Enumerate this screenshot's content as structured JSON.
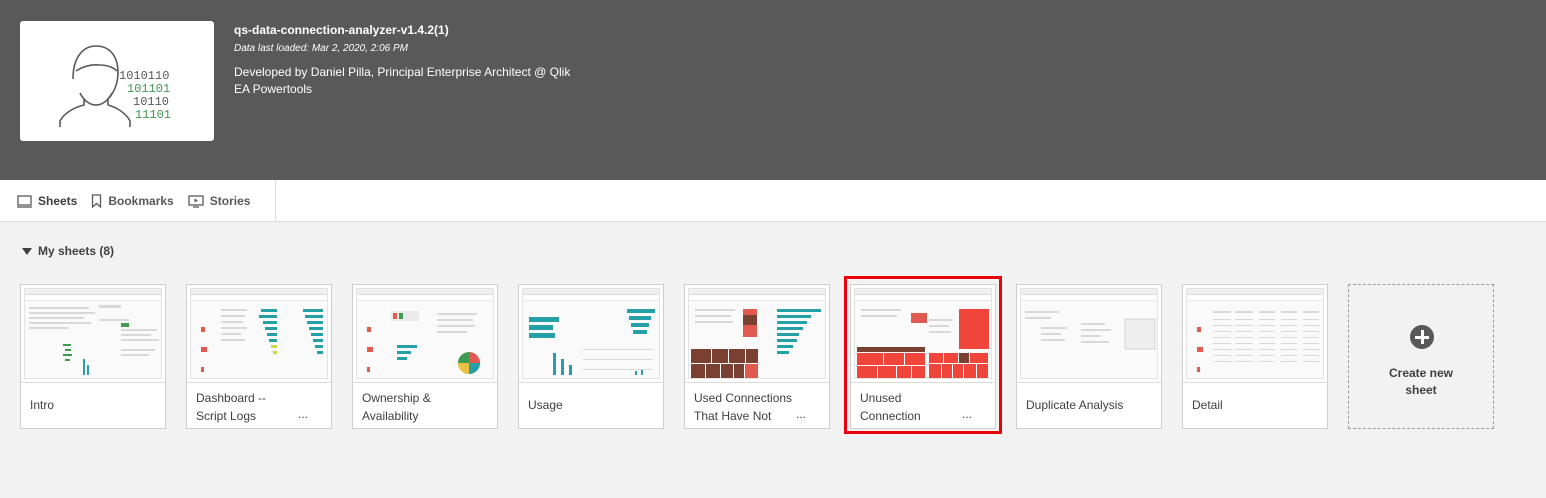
{
  "app": {
    "title": "qs-data-connection-analyzer-v1.4.2(1)",
    "date": "Data last loaded: Mar 2, 2020, 2:06 PM",
    "description_line1": "Developed by Daniel Pilla, Principal Enterprise Architect @ Qlik",
    "description_line2": "EA Powertools",
    "thumbnail_binary": [
      "1010110",
      "101101",
      "10110",
      "11101"
    ]
  },
  "tabs": {
    "sheets": "Sheets",
    "bookmarks": "Bookmarks",
    "stories": "Stories"
  },
  "section": {
    "title": "My sheets (8)"
  },
  "sheets": [
    {
      "line1": "Intro",
      "line2": "",
      "ellipsis": ""
    },
    {
      "line1": "Dashboard --",
      "line2": "Script Logs",
      "ellipsis": "..."
    },
    {
      "line1": "Ownership &",
      "line2": "Availability",
      "ellipsis": ""
    },
    {
      "line1": "Usage",
      "line2": "",
      "ellipsis": ""
    },
    {
      "line1": "Used Connections",
      "line2": "That Have Not",
      "ellipsis": "..."
    },
    {
      "line1": "Unused",
      "line2": "Connection",
      "ellipsis": "..."
    },
    {
      "line1": "Duplicate Analysis",
      "line2": "",
      "ellipsis": ""
    },
    {
      "line1": "Detail",
      "line2": "",
      "ellipsis": ""
    }
  ],
  "create": {
    "line1": "Create new",
    "line2": "sheet"
  },
  "colors": {
    "header_bg": "#595959",
    "highlight": "#e8000d",
    "teal": "#26a0a7",
    "green": "#3e9a4e",
    "red_map": "#f0453a",
    "brown_map": "#7a4032"
  },
  "icons": {
    "sheets": "sheets-icon",
    "bookmarks": "bookmark-icon",
    "stories": "stories-icon",
    "collapse": "triangle-down-icon",
    "create": "plus-circle-icon",
    "avatar": "user-avatar-icon"
  }
}
